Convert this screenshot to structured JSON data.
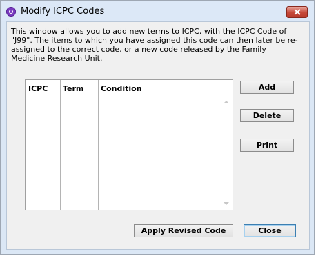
{
  "window": {
    "title": "Modify ICPC Codes",
    "description": "This window allows you to add new terms to ICPC, with the ICPC Code of \"J99\". The items to which you have assigned this code can then later be re-assigned to the correct code, or a new code released by the Family Medicine Research Unit."
  },
  "grid": {
    "columns": [
      "ICPC",
      "Term",
      "Condition"
    ],
    "rows": []
  },
  "buttons": {
    "add": "Add",
    "delete": "Delete",
    "print": "Print",
    "apply": "Apply Revised Code",
    "close": "Close"
  },
  "icons": {
    "app": "app-circle-icon",
    "close": "close-icon"
  },
  "colors": {
    "close_button": "#c74a3b",
    "app_icon": "#7a3cc0",
    "default_button_border": "#3c7fb1"
  }
}
